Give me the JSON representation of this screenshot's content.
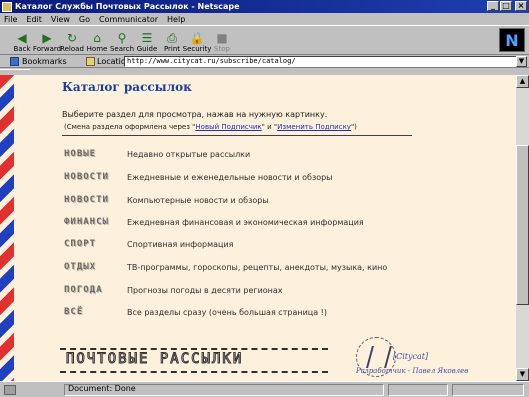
{
  "window": {
    "title": "Каталог Службы Почтовых Рассылок - Netscape",
    "controls": [
      "_",
      "□",
      "×"
    ]
  },
  "menu": [
    "File",
    "Edit",
    "View",
    "Go",
    "Communicator",
    "Help"
  ],
  "toolbar": {
    "buttons": [
      {
        "label": "Back",
        "icon": "back-arrow-icon",
        "glyph": "◀"
      },
      {
        "label": "Forward",
        "icon": "forward-arrow-icon",
        "glyph": "▶"
      },
      {
        "label": "Reload",
        "icon": "reload-icon",
        "glyph": "↻"
      },
      {
        "label": "Home",
        "icon": "home-icon",
        "glyph": "⌂"
      },
      {
        "label": "Search",
        "icon": "search-icon",
        "glyph": "⚲"
      },
      {
        "label": "Guide",
        "icon": "guide-icon",
        "glyph": "☰"
      },
      {
        "label": "Print",
        "icon": "print-icon",
        "glyph": "⎙"
      },
      {
        "label": "Security",
        "icon": "lock-icon",
        "glyph": "🔒"
      },
      {
        "label": "Stop",
        "icon": "stop-icon",
        "glyph": "■"
      }
    ],
    "brand": "N"
  },
  "location": {
    "bookmarks_label": "Bookmarks",
    "label": "Location:",
    "url": "http://www.citycat.ru/subscribe/catalog/"
  },
  "page": {
    "heading": "Каталог рассылок",
    "intro": "Выберите раздел для просмотра, нажав на нужную картинку.",
    "hint_prefix": "(Смена раздела оформлена через \"",
    "hint_link1": "Новый Подписчик",
    "hint_mid": "\" и \"",
    "hint_link2": "Изменить Подписку",
    "hint_suffix": "\")",
    "sections": [
      {
        "label": "НОВЫЕ",
        "desc": "Недавно открытые рассылки"
      },
      {
        "label": "НОВОСТИ",
        "desc": "Ежедневные и еженедельные новости и обзоры"
      },
      {
        "label": "НОВОСТИ",
        "desc": "Компьютерные новости и обзоры"
      },
      {
        "label": "ФИНАНСЫ",
        "desc": "Ежедневная финансовая и экономическая информация"
      },
      {
        "label": "СПОРТ",
        "desc": "Спортивная информация"
      },
      {
        "label": "ОТДЫХ",
        "desc": "ТВ-программы, гороскопы, рецепты, анекдоты, музыка, кино"
      },
      {
        "label": "ПОГОДА",
        "desc": "Прогнозы погоды в десяти регионах"
      },
      {
        "label": "ВСЁ",
        "desc": "Все разделы сразу (очень большая страница !)"
      }
    ],
    "footer_banner": "ПОЧТОВЫЕ РАССЫЛКИ",
    "signature_top": "[Citycat]",
    "signature_bottom": "Разработчик - Павел Яковлев"
  },
  "status": {
    "text": "Document: Done"
  },
  "colors": {
    "page_bg": "#fdf0dc",
    "heading": "#1a3ea0",
    "airmail_red": "#e03030",
    "airmail_blue": "#2040c0"
  }
}
